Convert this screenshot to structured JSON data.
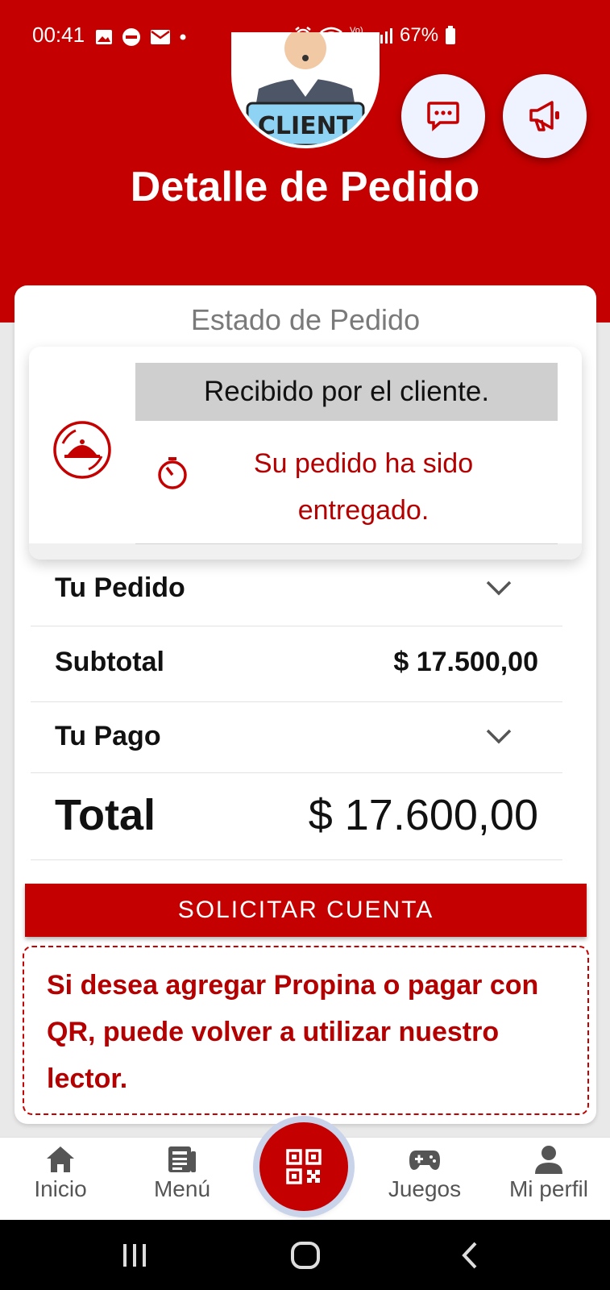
{
  "status_bar": {
    "time": "00:41",
    "battery": "67%",
    "network_label": "Vo) LTE"
  },
  "avatar": {
    "label": "CLIENT"
  },
  "header": {
    "title": "Detalle de Pedido"
  },
  "order_status": {
    "section_label": "Estado de Pedido",
    "state": "Recibido por el cliente.",
    "message_line1": "Su pedido ha sido",
    "message_line2": "entregado."
  },
  "summary": {
    "tu_pedido_label": "Tu Pedido",
    "subtotal_label": "Subtotal",
    "subtotal_value": "$ 17.500,00",
    "tu_pago_label": "Tu Pago",
    "total_label": "Total",
    "total_value": "$ 17.600,00"
  },
  "actions": {
    "solicitar_cuenta": "SOLICITAR CUENTA"
  },
  "note": {
    "text": "Si desea agregar Propina o pagar con QR, puede volver a utilizar nuestro lector."
  },
  "bottom_nav": {
    "inicio": "Inicio",
    "menu": "Menú",
    "juegos": "Juegos",
    "perfil": "Mi perfil"
  },
  "colors": {
    "brand_red": "#c40000",
    "text_red": "#b40000",
    "status_gray": "#cfcfcf"
  }
}
